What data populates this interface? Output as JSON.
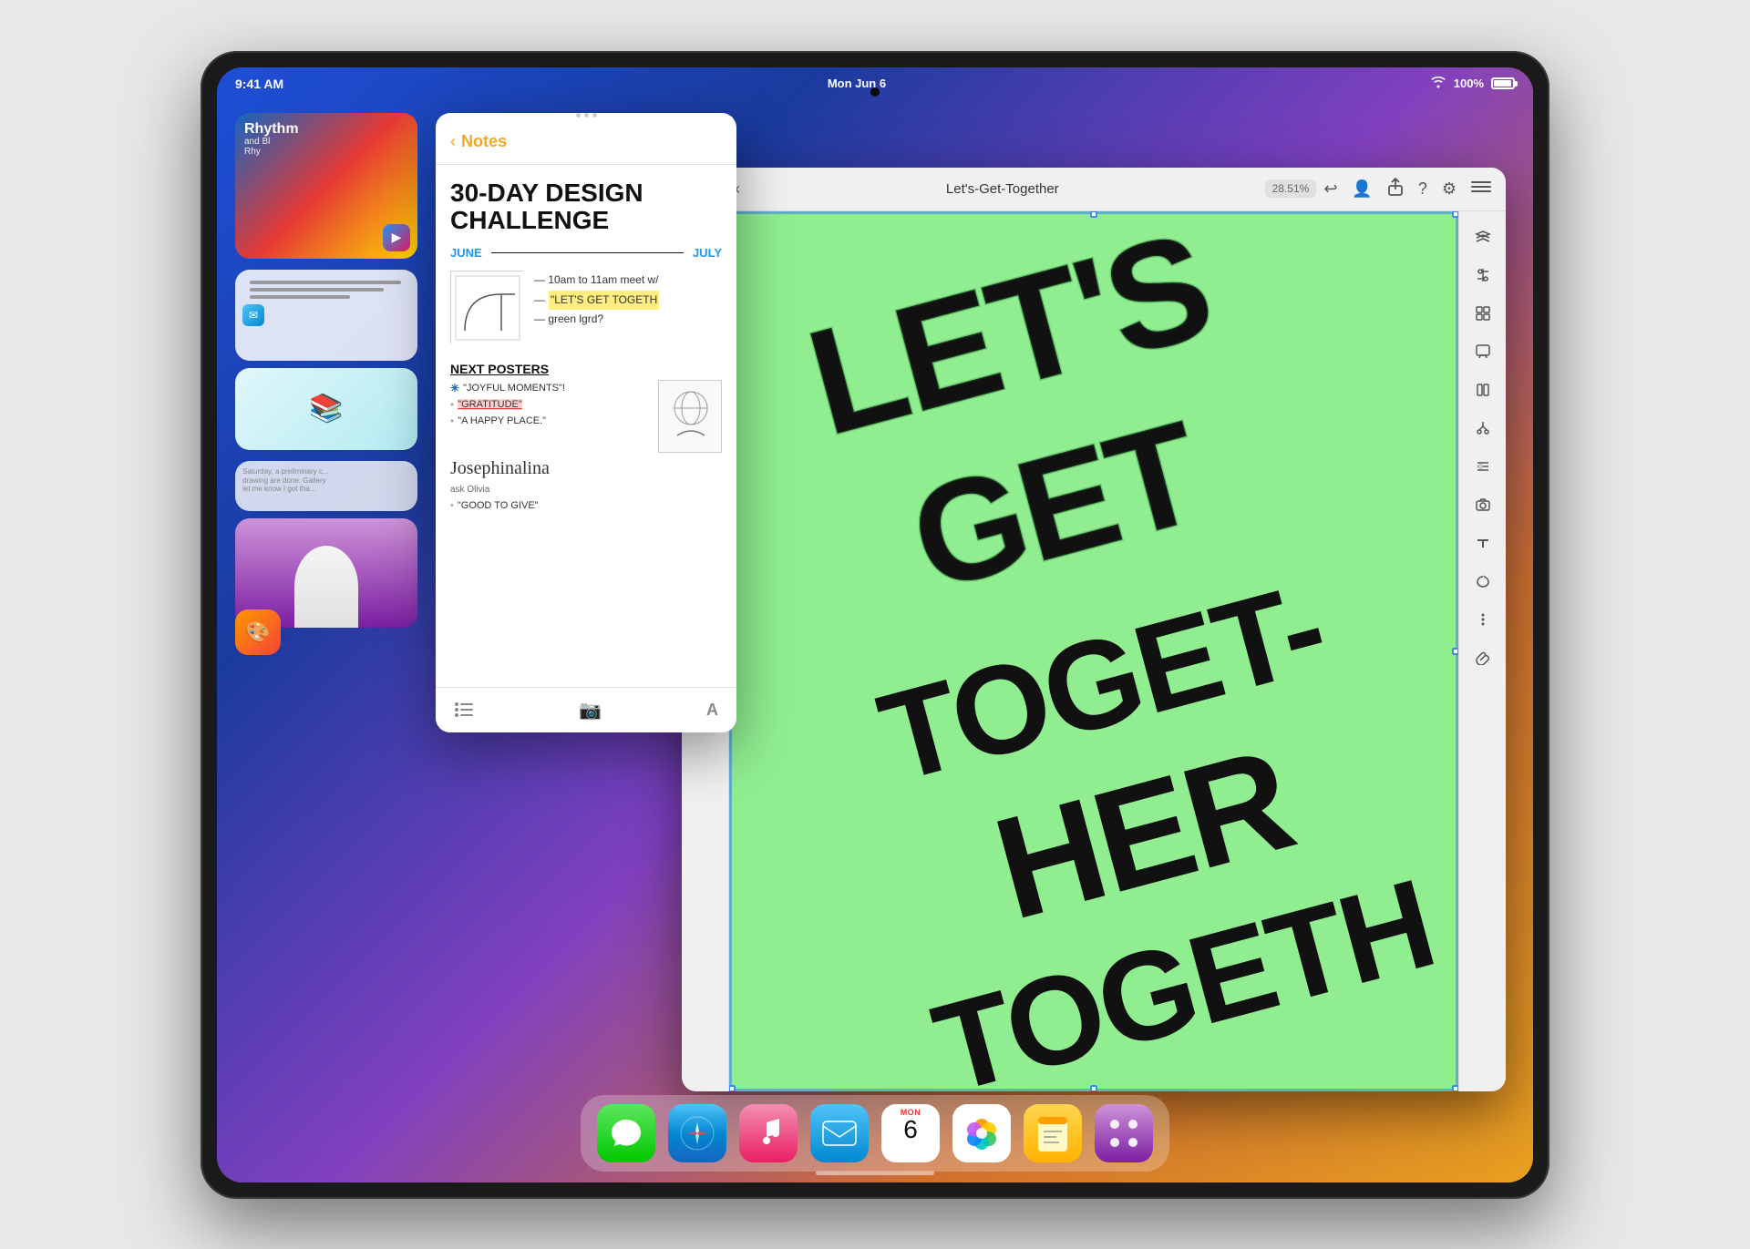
{
  "device": {
    "type": "iPad Pro",
    "status_bar": {
      "time": "9:41 AM",
      "date": "Mon Jun 6",
      "wifi": "WiFi",
      "battery": "100%"
    }
  },
  "notes_app": {
    "back_label": "Notes",
    "title": "30-DAY DESIGN CHALLENGE",
    "timeline": {
      "start": "JUNE",
      "end": "JULY"
    },
    "bullets": [
      "10am to 11am meet w/",
      "\"LET'S GET TOGETHA\"",
      "— green lgrd?"
    ],
    "section_title": "NEXT POSTERS",
    "poster_items": [
      "\"JOYFUL MOMENTS\"",
      "\"GRATITUDE\"",
      "\"A HAPPY PLACE.\""
    ],
    "signature": "Josephinalina",
    "note_bottom": "Ask Olivia",
    "last_item": "\"GOOD TO GIVE\""
  },
  "design_app": {
    "title": "Let's-Get-Together",
    "zoom": "28.51%",
    "back_label": "Back",
    "poster_text": "Let's Get Together",
    "poster_bg_color": "#90ee90"
  },
  "dock": {
    "apps": [
      {
        "id": "messages",
        "label": "Messages"
      },
      {
        "id": "safari",
        "label": "Safari"
      },
      {
        "id": "music",
        "label": "Music"
      },
      {
        "id": "mail",
        "label": "Mail"
      },
      {
        "id": "calendar",
        "label": "Calendar",
        "day_name": "MON",
        "day_num": "6"
      },
      {
        "id": "photos",
        "label": "Photos"
      },
      {
        "id": "notes",
        "label": "Notes"
      },
      {
        "id": "extras",
        "label": "Extras"
      }
    ]
  },
  "toolbar": {
    "undo_label": "↩",
    "person_label": "👤",
    "share_label": "⬆",
    "help_label": "?",
    "settings_label": "⚙",
    "more_label": "⋯"
  }
}
